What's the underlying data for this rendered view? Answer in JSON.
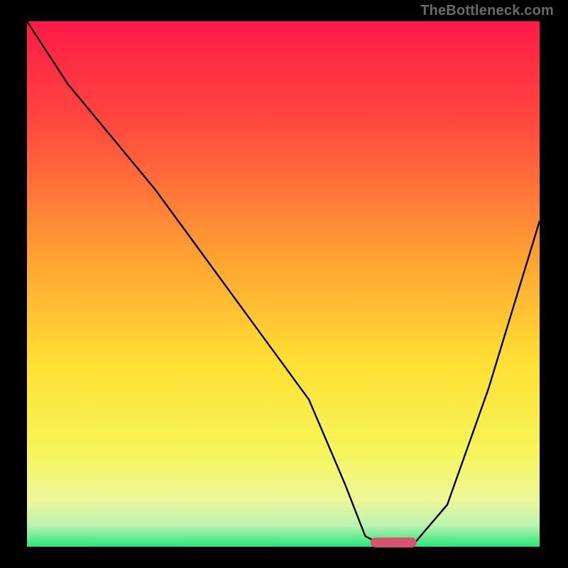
{
  "watermark": "TheBottleneck.com",
  "chart_data": {
    "type": "line",
    "title": "",
    "xlabel": "",
    "ylabel": "",
    "xlim": [
      0,
      100
    ],
    "ylim": [
      0,
      100
    ],
    "grid": false,
    "background": {
      "type": "vertical-gradient",
      "stops": [
        {
          "offset": 0,
          "color": "#ff1a48"
        },
        {
          "offset": 20,
          "color": "#ff4a3e"
        },
        {
          "offset": 45,
          "color": "#ffa233"
        },
        {
          "offset": 65,
          "color": "#ffe033"
        },
        {
          "offset": 82,
          "color": "#f5f55a"
        },
        {
          "offset": 91,
          "color": "#eef79a"
        },
        {
          "offset": 96,
          "color": "#b9f3b0"
        },
        {
          "offset": 100,
          "color": "#27e67a"
        }
      ]
    },
    "series": [
      {
        "name": "bottleneck-curve",
        "x": [
          0,
          8,
          25,
          40,
          55,
          62,
          66,
          70,
          75,
          82,
          90,
          100
        ],
        "y": [
          100,
          88,
          68,
          48,
          28,
          12,
          2,
          0,
          0,
          8,
          30,
          62
        ]
      }
    ],
    "marker": {
      "name": "optimal-range",
      "x_start": 67,
      "x_end": 76,
      "y": 0.8,
      "color": "#d5546b"
    }
  }
}
